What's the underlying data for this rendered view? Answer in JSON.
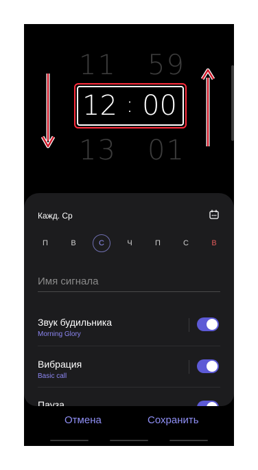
{
  "time_picker": {
    "hour_prev": "11",
    "minute_prev": "59",
    "hour": "12",
    "separator": ":",
    "minute": "00",
    "hour_next": "13",
    "minute_next": "01"
  },
  "alarm": {
    "repeat_label": "Кажд. Ср",
    "days": [
      {
        "label": "П",
        "selected": false
      },
      {
        "label": "В",
        "selected": false
      },
      {
        "label": "С",
        "selected": true
      },
      {
        "label": "Ч",
        "selected": false
      },
      {
        "label": "П",
        "selected": false
      },
      {
        "label": "С",
        "selected": false
      },
      {
        "label": "В",
        "selected": false
      }
    ],
    "name_placeholder": "Имя сигнала",
    "settings": [
      {
        "title": "Звук будильника",
        "subtitle": "Morning Glory",
        "enabled": true
      },
      {
        "title": "Вибрация",
        "subtitle": "Basic call",
        "enabled": true
      },
      {
        "title": "Пауза",
        "enabled": true
      }
    ]
  },
  "actions": {
    "cancel_label": "Отмена",
    "save_label": "Сохранить"
  },
  "colors": {
    "accent": "#5d5ad6",
    "highlight_border": "#ff2d3d",
    "sunday": "#e05a5a"
  }
}
